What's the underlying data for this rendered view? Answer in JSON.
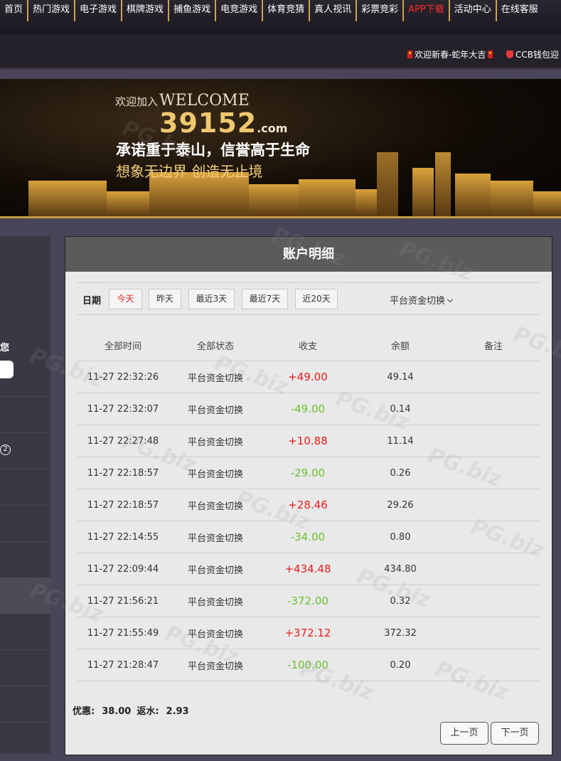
{
  "nav": {
    "items": [
      "首页",
      "热门游戏",
      "电子游戏",
      "棋牌游戏",
      "捕鱼游戏",
      "电竞游戏",
      "体育竞猜",
      "真人视讯",
      "彩票竞彩",
      "APP下载",
      "活动中心",
      "在线客服"
    ]
  },
  "notices": {
    "greeting": "欢迎新春-蛇年大吉",
    "ccb": "CCB钱包迎"
  },
  "banner": {
    "welcome_small": "欢迎加入",
    "welcome_big": "WELCOME",
    "site_number": "39152",
    "site_suffix": ".com",
    "slogan1": "承诺重于泰山，信誉高于生命",
    "slogan2": "想象无边界 创造无止境"
  },
  "sidebar": {
    "peek_text": "您",
    "peek_badge": "2"
  },
  "panel": {
    "title": "账户明细",
    "filter_label": "日期",
    "filters": [
      "今天",
      "昨天",
      "最近3天",
      "最近7天",
      "近20天"
    ],
    "platform_switch": "平台资金切换",
    "columns": [
      "全部时间",
      "全部状态",
      "收支",
      "余额",
      "备注"
    ],
    "rows": [
      {
        "time": "11-27 22:32:26",
        "status": "平台资金切换",
        "amount": "+49.00",
        "balance": "49.14",
        "note": ""
      },
      {
        "time": "11-27 22:32:07",
        "status": "平台资金切换",
        "amount": "-49.00",
        "balance": "0.14",
        "note": ""
      },
      {
        "time": "11-27 22:27:48",
        "status": "平台资金切换",
        "amount": "+10.88",
        "balance": "11.14",
        "note": ""
      },
      {
        "time": "11-27 22:18:57",
        "status": "平台资金切换",
        "amount": "-29.00",
        "balance": "0.26",
        "note": ""
      },
      {
        "time": "11-27 22:18:57",
        "status": "平台资金切换",
        "amount": "+28.46",
        "balance": "29.26",
        "note": ""
      },
      {
        "time": "11-27 22:14:55",
        "status": "平台资金切换",
        "amount": "-34.00",
        "balance": "0.80",
        "note": ""
      },
      {
        "time": "11-27 22:09:44",
        "status": "平台资金切换",
        "amount": "+434.48",
        "balance": "434.80",
        "note": ""
      },
      {
        "time": "11-27 21:56:21",
        "status": "平台资金切换",
        "amount": "-372.00",
        "balance": "0.32",
        "note": ""
      },
      {
        "time": "11-27 21:55:49",
        "status": "平台资金切换",
        "amount": "+372.12",
        "balance": "372.32",
        "note": ""
      },
      {
        "time": "11-27 21:28:47",
        "status": "平台资金切换",
        "amount": "-100.00",
        "balance": "0.20",
        "note": ""
      }
    ],
    "summary": {
      "discount_label": "优惠:",
      "discount_value": "38.00",
      "rebate_label": "返水:",
      "rebate_value": "2.93"
    },
    "prev_label": "上一页",
    "next_label": "下一页"
  },
  "watermark": "PG.biz",
  "colors": {
    "positive": "#e41c1c",
    "negative": "#6cbf2e",
    "gold": "#c9a44b",
    "app_link": "#ff2b2b"
  }
}
